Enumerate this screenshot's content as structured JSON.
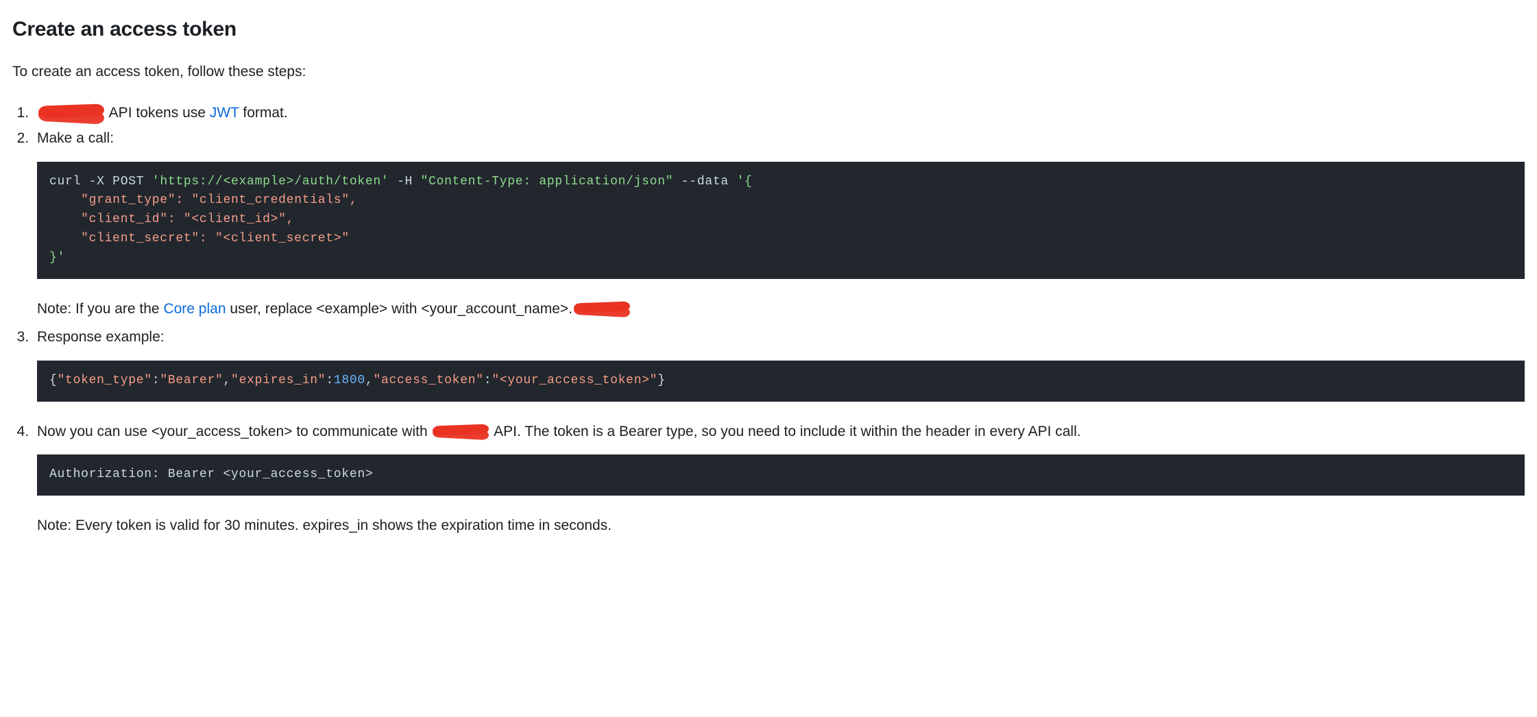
{
  "heading": "Create an access token",
  "intro": "To create an access token, follow these steps:",
  "steps": {
    "s1": {
      "prefix_hidden": true,
      "text1": " API tokens use ",
      "link_label": "JWT",
      "text2": " format."
    },
    "s2": {
      "label": "Make a call:",
      "code": {
        "l1a": "curl -X POST ",
        "l1b": "'https://<example>/auth/token'",
        "l1c": " -H ",
        "l1d": "\"Content-Type: application/json\"",
        "l1e": " --data ",
        "l1f": "'{",
        "l2a": "    \"grant_type\"",
        "l2b": ": ",
        "l2c": "\"client_credentials\"",
        "l2d": ",",
        "l3a": "    \"client_id\"",
        "l3b": ": ",
        "l3c": "\"<client_id>\"",
        "l3d": ",",
        "l4a": "    \"client_secret\"",
        "l4b": ": ",
        "l4c": "\"<client_secret>\"",
        "l5": "}'"
      },
      "note_prefix": "Note: If you are the ",
      "note_link": "Core plan",
      "note_mid": " user, replace <example> with <your_account_name>.",
      "note_suffix_hidden": true
    },
    "s3": {
      "label": "Response example:",
      "code": {
        "b1": "{",
        "k1": "\"token_type\"",
        "c1": ":",
        "v1": "\"Bearer\"",
        "c2": ",",
        "k2": "\"expires_in\"",
        "c3": ":",
        "n1": "1800",
        "c4": ",",
        "k3": "\"access_token\"",
        "c5": ":",
        "v3": "\"<your_access_token>\"",
        "b2": "}"
      }
    },
    "s4": {
      "text1": "Now you can use <your_access_token> to communicate with ",
      "hidden_mid": true,
      "text2": " API. The token is a Bearer type, so you need to include it within the header in every API call.",
      "code_line": "Authorization: Bearer <your_access_token>",
      "note": "Note: Every token is valid for 30 minutes. expires_in shows the expiration time in seconds."
    }
  }
}
